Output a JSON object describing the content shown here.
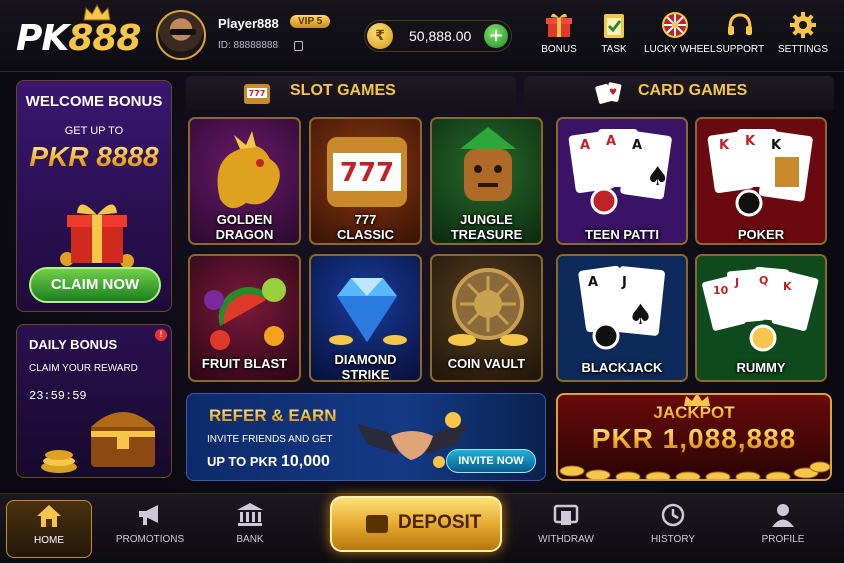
{
  "brand": {
    "logo_prefix": "PK",
    "logo_suffix": "888"
  },
  "user": {
    "name": "Player888",
    "vip": "VIP 5",
    "id_label": "ID: 88888888"
  },
  "wallet": {
    "balance": "50,888.00",
    "coin_symbol": "₹"
  },
  "top_nav": [
    {
      "label": "BONUS",
      "icon": "gift-icon"
    },
    {
      "label": "TASK",
      "icon": "clipboard-check-icon"
    },
    {
      "label": "LUCKY WHEEL",
      "icon": "wheel-icon"
    },
    {
      "label": "SUPPORT",
      "icon": "headset-icon"
    },
    {
      "label": "SETTINGS",
      "icon": "gear-icon"
    }
  ],
  "welcome": {
    "title": "WELCOME BONUS",
    "subtitle": "GET UP TO",
    "amount": "PKR 8888",
    "cta": "CLAIM NOW"
  },
  "daily": {
    "title": "DAILY BONUS",
    "subtitle": "CLAIM YOUR REWARD",
    "timer": "23:59:59",
    "badge": "!"
  },
  "slots": {
    "heading": "SLOT GAMES",
    "games": [
      {
        "name": "GOLDEN DRAGON",
        "line1": "GOLDEN",
        "line2": "DRAGON"
      },
      {
        "name": "777 CLASSIC",
        "line1": "777",
        "line2": "CLASSIC"
      },
      {
        "name": "JUNGLE TREASURE",
        "line1": "JUNGLE",
        "line2": "TREASURE"
      },
      {
        "name": "FRUIT BLAST",
        "line1": "FRUIT BLAST",
        "line2": ""
      },
      {
        "name": "DIAMOND STRIKE",
        "line1": "DIAMOND",
        "line2": "STRIKE"
      },
      {
        "name": "COIN VAULT",
        "line1": "COIN VAULT",
        "line2": ""
      }
    ]
  },
  "cards": {
    "heading": "CARD GAMES",
    "games": [
      {
        "name": "TEEN PATTI",
        "color": "#4a1a7a"
      },
      {
        "name": "POKER",
        "color": "#7a0e12"
      },
      {
        "name": "BLACKJACK",
        "color": "#0e2a6a"
      },
      {
        "name": "RUMMY",
        "color": "#0e4a1c"
      }
    ]
  },
  "refer": {
    "title": "REFER & EARN",
    "line1": "INVITE FRIENDS AND GET",
    "line2_prefix": "UP TO PKR",
    "line2_amount": "10,000",
    "cta": "INVITE NOW"
  },
  "jackpot": {
    "title": "JACKPOT",
    "amount": "PKR 1,088,888"
  },
  "bottom_nav": [
    {
      "label": "HOME",
      "icon": "home-icon",
      "active": true
    },
    {
      "label": "PROMOTIONS",
      "icon": "megaphone-icon"
    },
    {
      "label": "BANK",
      "icon": "bank-icon"
    },
    {
      "label": "DEPOSIT",
      "icon": "wallet-icon"
    },
    {
      "label": "WITHDRAW",
      "icon": "withdraw-icon"
    },
    {
      "label": "HISTORY",
      "icon": "history-icon"
    },
    {
      "label": "PROFILE",
      "icon": "profile-icon"
    }
  ],
  "colors": {
    "accent_gold": "#f6c64a",
    "claim_green": "#1c7f1e",
    "refer_blue": "#143a86",
    "jackpot_red": "#6a0a0a"
  }
}
